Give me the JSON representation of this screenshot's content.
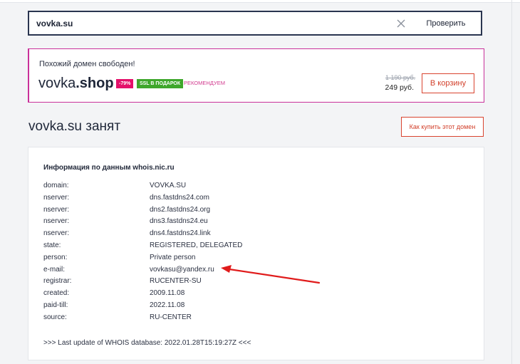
{
  "search": {
    "value": "vovka.su",
    "button_label": "Проверить"
  },
  "promo": {
    "title": "Похожий домен свободен!",
    "domain_name": "vovka",
    "domain_tld": ".shop",
    "discount_badge": "-79%",
    "ssl_badge": "SSL В ПОДАРОК",
    "recommend_label": "РЕКОМЕНДУЕМ",
    "old_price": "1 190 руб.",
    "new_price": "249 руб.",
    "cart_button": "В корзину",
    "colors": {
      "accent": "#c9309a",
      "discount": "#e4106a",
      "ssl": "#3ea72b",
      "action": "#d9442f"
    }
  },
  "status": {
    "title": "vovka.su занят",
    "buy_button": "Как купить этот домен"
  },
  "whois": {
    "heading": "Информация по данным whois.nic.ru",
    "rows": [
      {
        "key": "domain:",
        "value": "VOVKA.SU"
      },
      {
        "key": "nserver:",
        "value": "dns.fastdns24.com"
      },
      {
        "key": "nserver:",
        "value": "dns2.fastdns24.org"
      },
      {
        "key": "nserver:",
        "value": "dns3.fastdns24.eu"
      },
      {
        "key": "nserver:",
        "value": "dns4.fastdns24.link"
      },
      {
        "key": "state:",
        "value": "REGISTERED, DELEGATED"
      },
      {
        "key": "person:",
        "value": "Private person"
      },
      {
        "key": "e-mail:",
        "value": "vovkasu@yandex.ru"
      },
      {
        "key": "registrar:",
        "value": "RUCENTER-SU"
      },
      {
        "key": "created:",
        "value": "2009.11.08"
      },
      {
        "key": "paid-till:",
        "value": "2022.11.08"
      },
      {
        "key": "source:",
        "value": "RU-CENTER"
      }
    ],
    "footer": ">>> Last update of WHOIS database: 2022.01.28T15:19:27Z <<<"
  },
  "annotation": {
    "arrow_color": "#e01b1b",
    "icon": "arrow-annotation-icon"
  }
}
